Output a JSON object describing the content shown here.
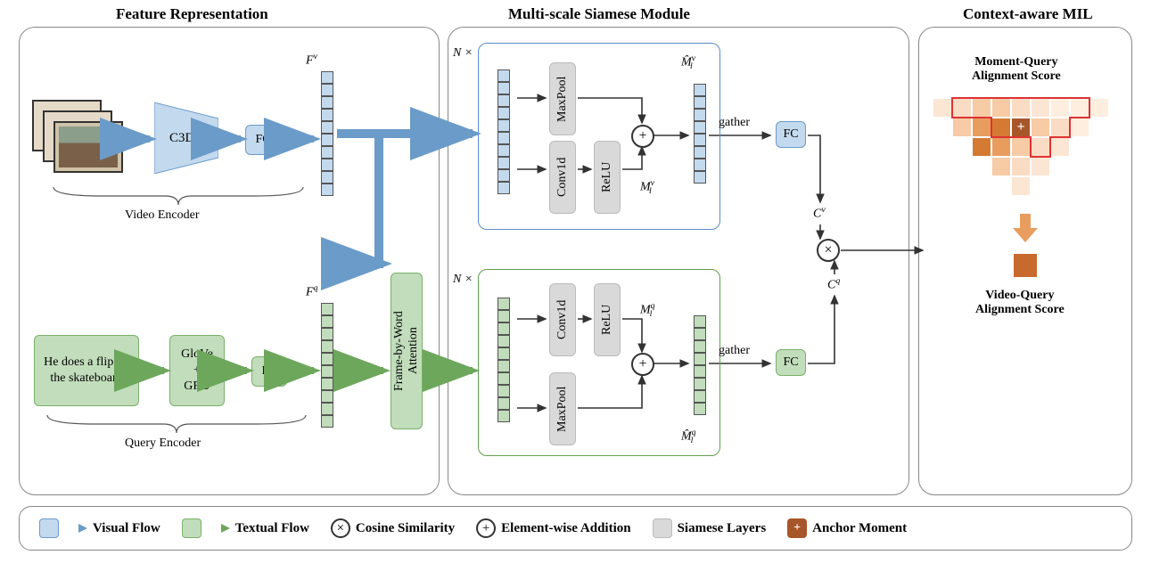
{
  "titles": {
    "feature": "Feature Representation",
    "siamese": "Multi-scale Siamese Module",
    "mil": "Context-aware MIL"
  },
  "feature": {
    "c3d": "C3D",
    "fc_v": "FC",
    "glove_gru": "GloVe\n+\nGRU",
    "fc_q": "FC",
    "query_text": "He does a flip on the skateboard",
    "video_encoder": "Video Encoder",
    "query_encoder": "Query Encoder",
    "Fv": "F",
    "Fv_sup": "v",
    "Fq": "F",
    "Fq_sup": "q",
    "frame_attn": "Frame-by-Word\nAttention"
  },
  "siamese": {
    "N": "N ×",
    "maxpool": "MaxPool",
    "conv1d": "Conv1d",
    "relu": "ReLU",
    "gather": "gather",
    "fc": "FC",
    "Mhat_v": "M̂",
    "M_v": "M",
    "Mhat_q": "M̂",
    "M_q": "M",
    "Cv": "C",
    "Cq": "C"
  },
  "mil": {
    "moment_query": "Moment-Query\nAlignment Score",
    "video_query": "Video-Query\nAlignment Score"
  },
  "legend": {
    "visual_flow": "Visual Flow",
    "textual_flow": "Textual Flow",
    "cosine": "Cosine Similarity",
    "elemwise": "Element-wise Addition",
    "siamese_layers": "Siamese Layers",
    "anchor": "Anchor Moment"
  }
}
